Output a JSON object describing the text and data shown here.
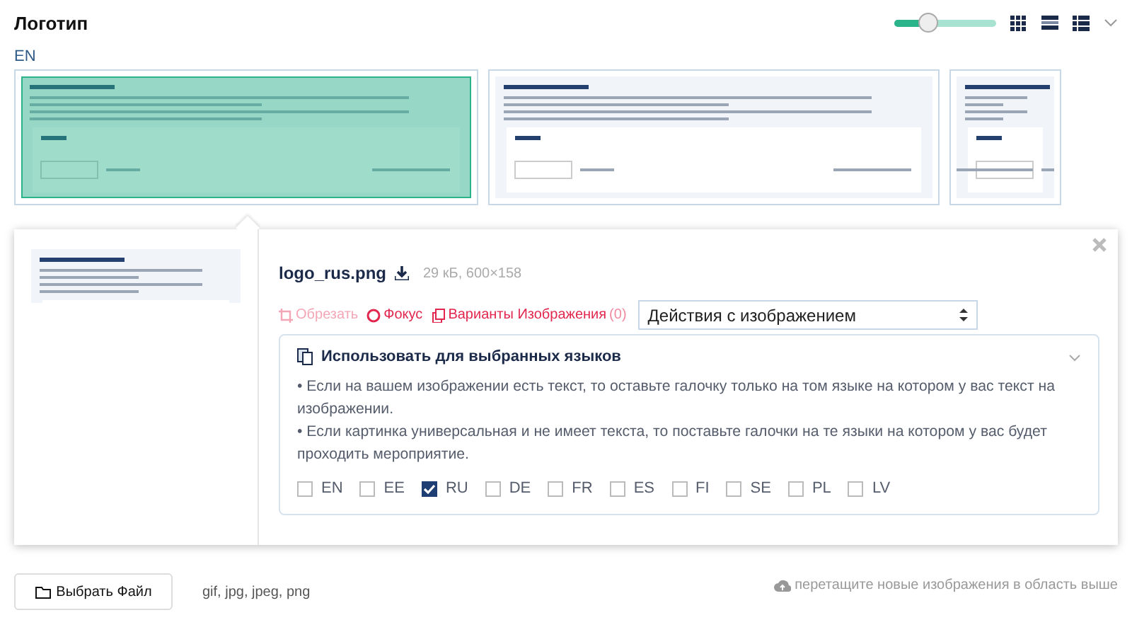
{
  "header": {
    "title": "Логотип",
    "zoom": {
      "level": 0.33
    }
  },
  "language_label": "EN",
  "thumbnails": [
    {
      "selected": true
    },
    {
      "selected": false
    },
    {
      "selected": false
    }
  ],
  "detail": {
    "file_name": "logo_rus.png",
    "file_info": "29 кБ, 600×158",
    "actions": [
      {
        "kind": "crop",
        "label": "Обрезать",
        "disabled": true
      },
      {
        "kind": "focus",
        "label": "Фокус",
        "disabled": false
      },
      {
        "kind": "variants",
        "label": "Варианты Изображения",
        "count": "(0)",
        "disabled": false
      }
    ],
    "action_select": {
      "value": "Действия с изображением"
    },
    "languages_panel": {
      "title": "Использовать для выбранных языков",
      "expanded": true,
      "notes": [
        "• Если на вашем изображении есть текст, то оставьте галочку только на том языке на котором у вас текст на изображении.",
        "• Если картинка универсальная и не имеет текста, то поставьте галочки на те языки на котором у вас будет проходить мероприятие."
      ],
      "languages": [
        {
          "code": "EN",
          "checked": false
        },
        {
          "code": "EE",
          "checked": false
        },
        {
          "code": "RU",
          "checked": true
        },
        {
          "code": "DE",
          "checked": false
        },
        {
          "code": "FR",
          "checked": false
        },
        {
          "code": "ES",
          "checked": false
        },
        {
          "code": "FI",
          "checked": false
        },
        {
          "code": "SE",
          "checked": false
        },
        {
          "code": "PL",
          "checked": false
        },
        {
          "code": "LV",
          "checked": false
        }
      ]
    }
  },
  "footer": {
    "button": "Выбрать Файл",
    "formats": "gif, jpg, jpeg, png",
    "drop_hint": "перетащите новые изображения в область выше"
  }
}
